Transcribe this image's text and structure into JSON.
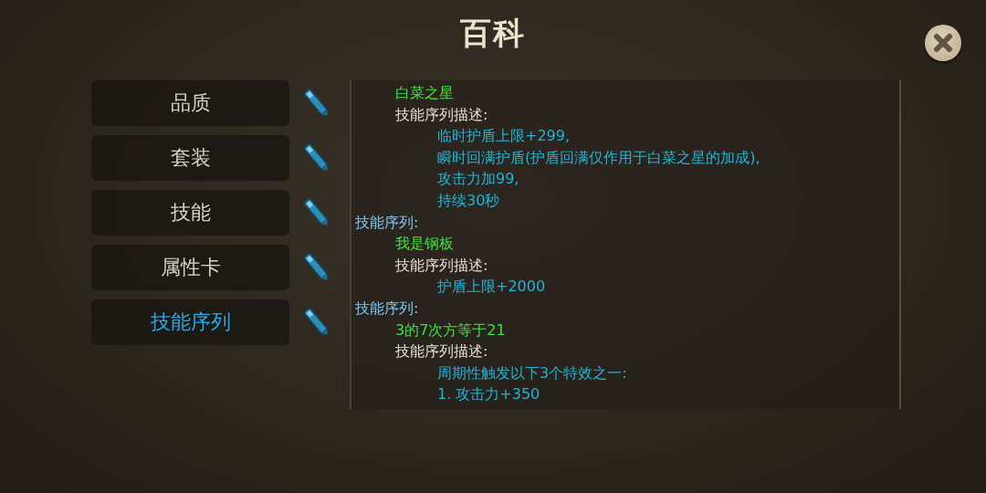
{
  "title": "百科",
  "categories": [
    {
      "label": "品质",
      "selected": false
    },
    {
      "label": "套装",
      "selected": false
    },
    {
      "label": "技能",
      "selected": false
    },
    {
      "label": "属性卡",
      "selected": false
    },
    {
      "label": "技能序列",
      "selected": true
    }
  ],
  "content": [
    {
      "kind": "name",
      "text": "白菜之星"
    },
    {
      "kind": "label",
      "text": "技能序列描述:"
    },
    {
      "kind": "desc",
      "text": "临时护盾上限+299,"
    },
    {
      "kind": "desc",
      "text": "瞬时回满护盾(护盾回满仅作用于白菜之星的加成),"
    },
    {
      "kind": "desc",
      "text": "攻击力加99,"
    },
    {
      "kind": "desc",
      "text": "持续30秒"
    },
    {
      "kind": "header",
      "text": "技能序列:"
    },
    {
      "kind": "name",
      "text": "我是钢板"
    },
    {
      "kind": "label",
      "text": "技能序列描述:"
    },
    {
      "kind": "desc",
      "text": "护盾上限+2000"
    },
    {
      "kind": "header",
      "text": "技能序列:"
    },
    {
      "kind": "name",
      "text": "3的7次方等于21"
    },
    {
      "kind": "label",
      "text": "技能序列描述:"
    },
    {
      "kind": "desc",
      "text": "周期性触发以下3个特效之一:"
    },
    {
      "kind": "desc",
      "text": "1. 攻击力+350"
    }
  ]
}
